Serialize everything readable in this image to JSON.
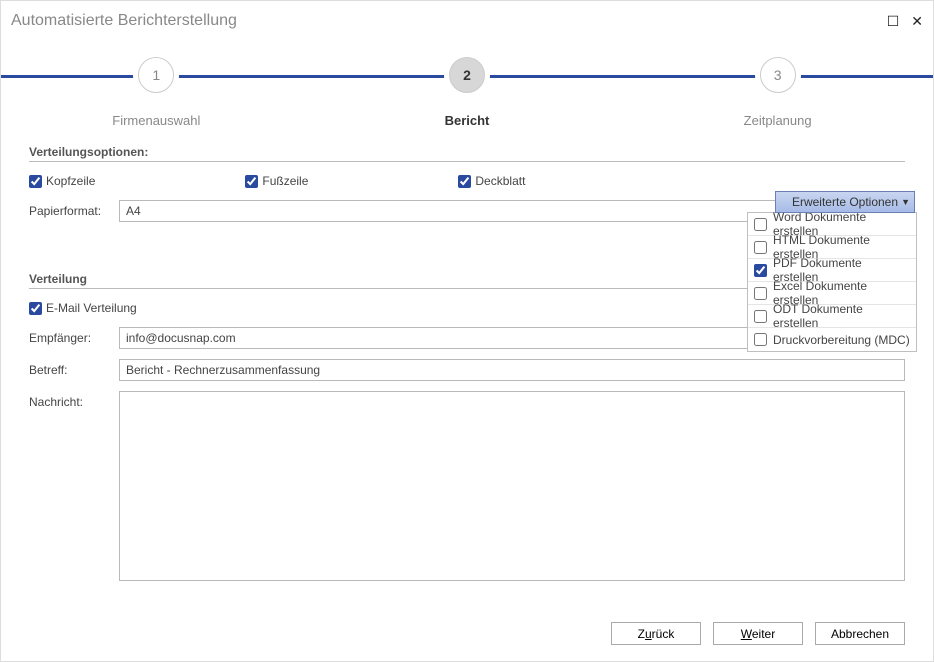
{
  "window": {
    "title": "Automatisierte Berichterstellung"
  },
  "stepper": {
    "steps": [
      {
        "num": "1",
        "label": "Firmenauswahl",
        "active": false
      },
      {
        "num": "2",
        "label": "Bericht",
        "active": true
      },
      {
        "num": "3",
        "label": "Zeitplanung",
        "active": false
      }
    ]
  },
  "sections": {
    "verteilungsoptionen_title": "Verteilungsoptionen:",
    "verteilung_title": "Verteilung"
  },
  "options": {
    "kopfzeile": {
      "label": "Kopfzeile",
      "checked": true
    },
    "fusszeile": {
      "label": "Fußzeile",
      "checked": true
    },
    "deckblatt": {
      "label": "Deckblatt",
      "checked": true
    }
  },
  "papier": {
    "label": "Papierformat:",
    "value": "A4"
  },
  "email": {
    "verteilung": {
      "label": "E-Mail Verteilung",
      "checked": true
    },
    "empfaenger_label": "Empfänger:",
    "empfaenger_value": "info@docusnap.com",
    "betreff_label": "Betreff:",
    "betreff_value": "Bericht - Rechnerzusammenfassung",
    "nachricht_label": "Nachricht:",
    "nachricht_value": ""
  },
  "dropdown": {
    "button_label": "Erweiterte Optionen",
    "items": [
      {
        "label": "Word Dokumente erstellen",
        "checked": false
      },
      {
        "label": "HTML Dokumente erstellen",
        "checked": false
      },
      {
        "label": "PDF Dokumente  erstellen",
        "checked": true
      },
      {
        "label": "Excel Dokumente erstellen",
        "checked": false
      },
      {
        "label": "ODT Dokumente  erstellen",
        "checked": false
      },
      {
        "label": "Druckvorbereitung (MDC)",
        "checked": false
      }
    ]
  },
  "buttons": {
    "back": "Zurück",
    "next": "Weiter",
    "cancel": "Abbrechen"
  }
}
